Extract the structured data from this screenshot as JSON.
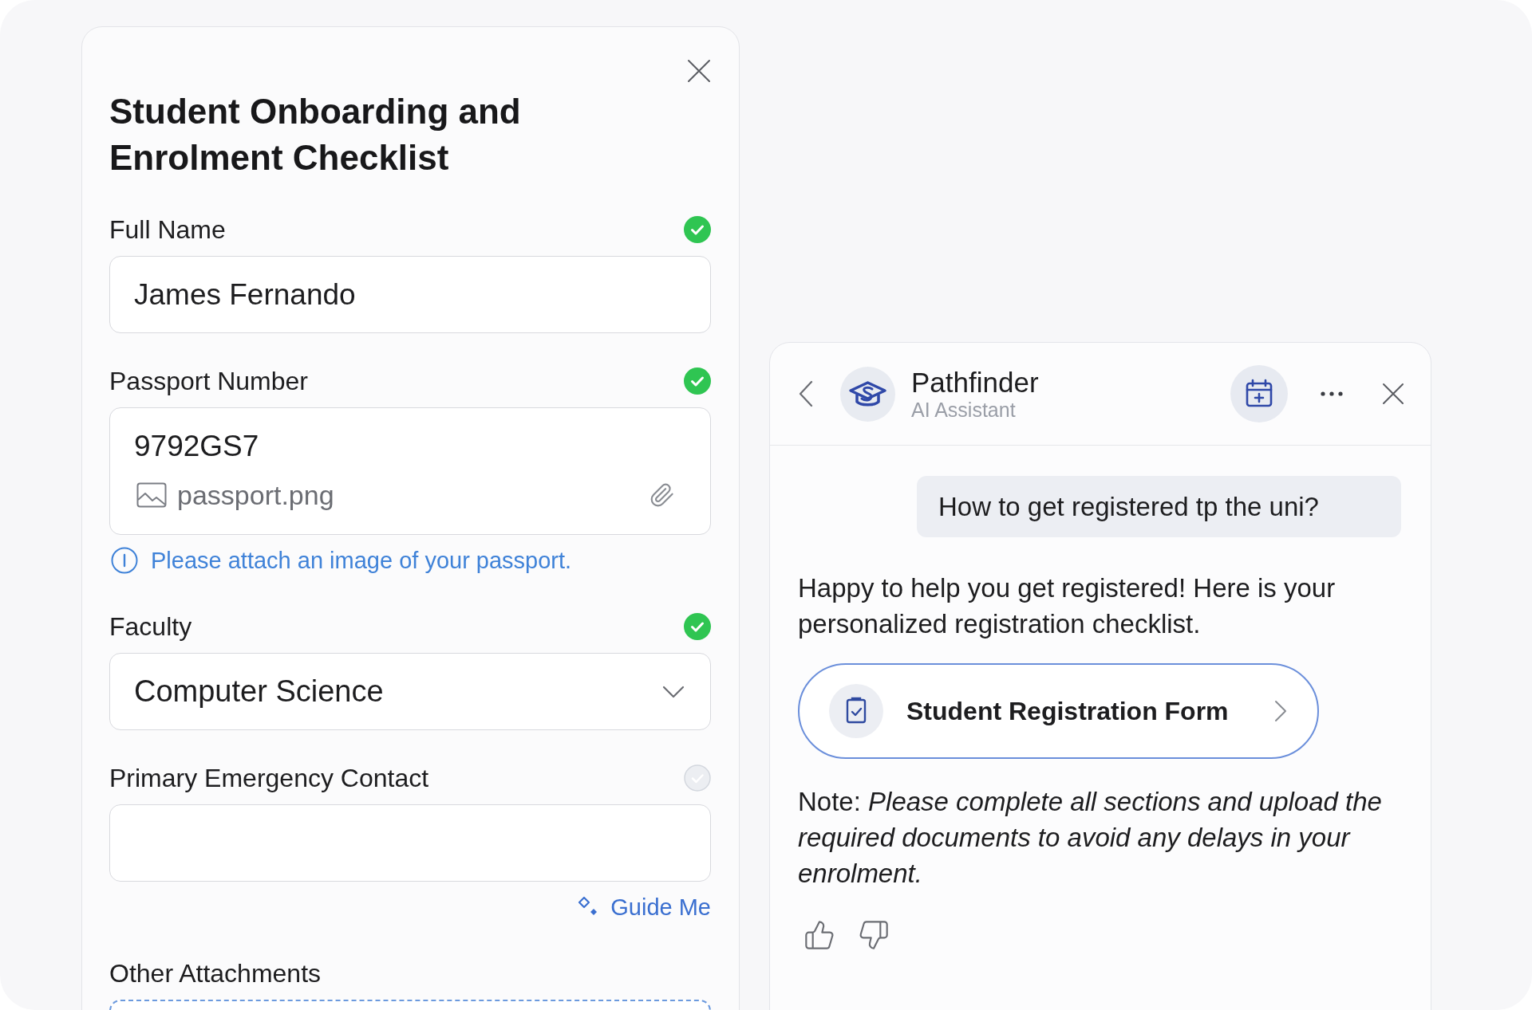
{
  "form": {
    "title": "Student Onboarding and Enrolment Checklist",
    "fields": [
      {
        "kind": "text",
        "label": "Full Name",
        "value": "James Fernando",
        "complete": true
      },
      {
        "kind": "file",
        "label": "Passport Number",
        "value": "9792GS7",
        "attachment": "passport.png",
        "hint": "Please attach an image of your passport.",
        "complete": true
      },
      {
        "kind": "select",
        "label": "Faculty",
        "value": "Computer Science",
        "complete": true
      },
      {
        "kind": "text",
        "label": "Primary Emergency Contact",
        "complete": false,
        "action": "Guide Me"
      },
      {
        "kind": "upload",
        "label": "Other Attachments"
      }
    ]
  },
  "chat": {
    "title": "Pathfinder",
    "subtitle": "AI Assistant",
    "messages": [
      {
        "kind": "user",
        "text": "How to get registered tp the uni?"
      },
      {
        "kind": "assistant",
        "text": "Happy to help you get registered! Here is your personalized registration checklist."
      },
      {
        "kind": "link_card",
        "text": "Student Registration Form"
      },
      {
        "kind": "assistant",
        "text": "Note: *Please complete all sections and upload the required documents to avoid any delays in your enrolment.*"
      }
    ]
  }
}
